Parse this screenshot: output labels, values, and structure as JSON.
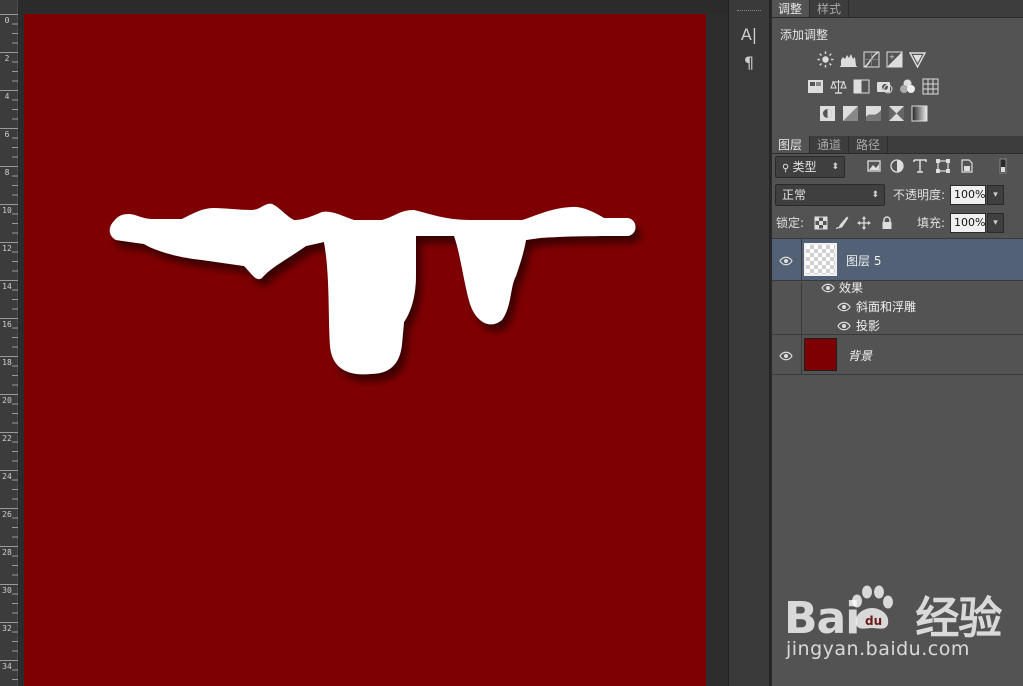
{
  "ruler": {
    "labels": [
      "0",
      "2",
      "4",
      "6",
      "8",
      "10",
      "12",
      "14",
      "16",
      "18",
      "20",
      "22",
      "24",
      "26",
      "28",
      "30",
      "32",
      "34"
    ]
  },
  "canvas": {
    "background": "#7e0002",
    "shape_color": "#ffffff"
  },
  "tool_strip": {
    "char_icon": "A|",
    "para_icon": "¶"
  },
  "adjustments_panel": {
    "tabs": [
      {
        "label": "调整",
        "active": true
      },
      {
        "label": "样式",
        "active": false
      }
    ],
    "title": "添加调整",
    "icons": [
      "brightness-icon",
      "levels-icon",
      "curves-icon",
      "exposure-icon",
      "vibrance-icon",
      "hue-saturation-icon",
      "color-balance-icon",
      "black-white-icon",
      "photo-filter-icon",
      "channel-mixer-icon",
      "color-lookup-icon",
      "invert-icon",
      "posterize-icon",
      "threshold-icon",
      "selective-color-icon",
      "gradient-map-icon"
    ]
  },
  "layers_panel": {
    "tabs": [
      {
        "label": "图层",
        "active": true
      },
      {
        "label": "通道",
        "active": false
      },
      {
        "label": "路径",
        "active": false
      }
    ],
    "filter_label": "类型",
    "blend_mode": "正常",
    "opacity_label": "不透明度:",
    "opacity_value": "100%",
    "lock_label": "锁定:",
    "fill_label": "填充:",
    "fill_value": "100%",
    "layers": [
      {
        "name": "图层 5",
        "selected": true
      },
      {
        "name": "背景",
        "selected": false
      }
    ],
    "effects_label": "效果",
    "effects": [
      "斜面和浮雕",
      "投影"
    ]
  },
  "watermark": {
    "logo": "Bai",
    "logo_suffix": "经验",
    "url": "jingyan.baidu.com"
  },
  "colors": {
    "selected_row": "#526175",
    "panel_bg": "#535353",
    "background_swatch": "#7e0002"
  }
}
